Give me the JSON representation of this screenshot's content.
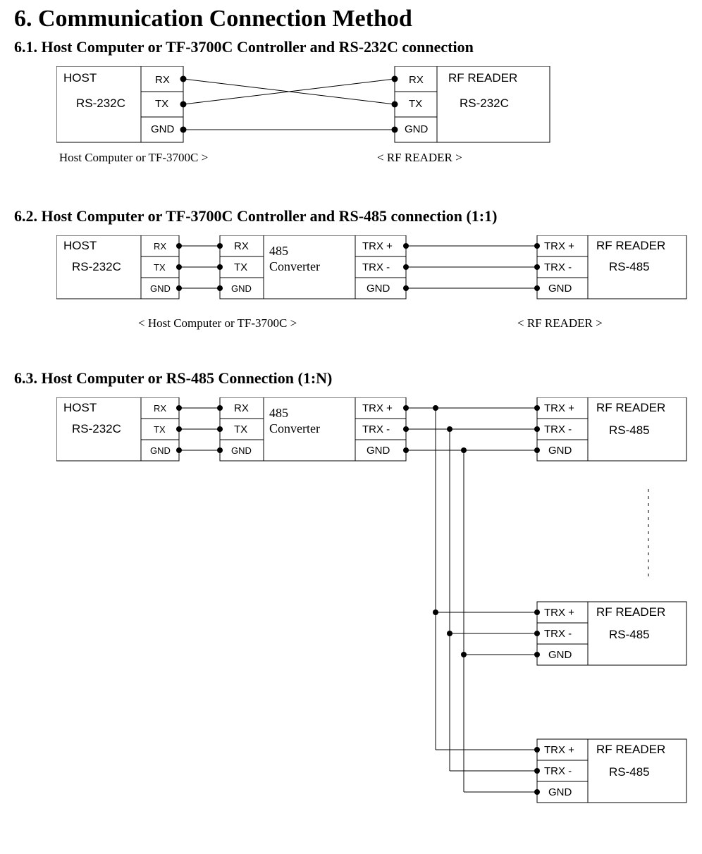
{
  "title": "6. Communication Connection Method",
  "s61": {
    "heading": "6.1.  Host Computer or TF-3700C Controller and RS-232C connection",
    "host_label": "HOST",
    "host_sub": "RS-232C",
    "reader_label": "RF READER",
    "reader_sub": "RS-232C",
    "pins": {
      "rx": "RX",
      "tx": "TX",
      "gnd": "GND"
    },
    "caption_left": "< Host Computer or TF-3700C >",
    "caption_right": "< RF READER >"
  },
  "s62": {
    "heading": "6.2.  Host Computer or TF-3700C Controller and RS-485 connection (1:1)",
    "host_label": "HOST",
    "host_sub": "RS-232C",
    "conv_label1": "485",
    "conv_label2": "Converter",
    "reader_label": "RF READER",
    "reader_sub": "RS-485",
    "pins": {
      "rx": "RX",
      "tx": "TX",
      "gnd": "GND",
      "trxp": "TRX +",
      "trxm": "TRX -"
    },
    "caption_left": "< Host Computer or TF-3700C >",
    "caption_right": "< RF READER >"
  },
  "s63": {
    "heading": "6.3.  Host Computer or RS-485 Connection (1:N)",
    "host_label": "HOST",
    "host_sub": "RS-232C",
    "conv_label1": "485",
    "conv_label2": "Converter",
    "reader_label": "RF READER",
    "reader_sub": "RS-485",
    "pins": {
      "rx": "RX",
      "tx": "TX",
      "gnd": "GND",
      "trxp": "TRX +",
      "trxm": "TRX -"
    }
  }
}
